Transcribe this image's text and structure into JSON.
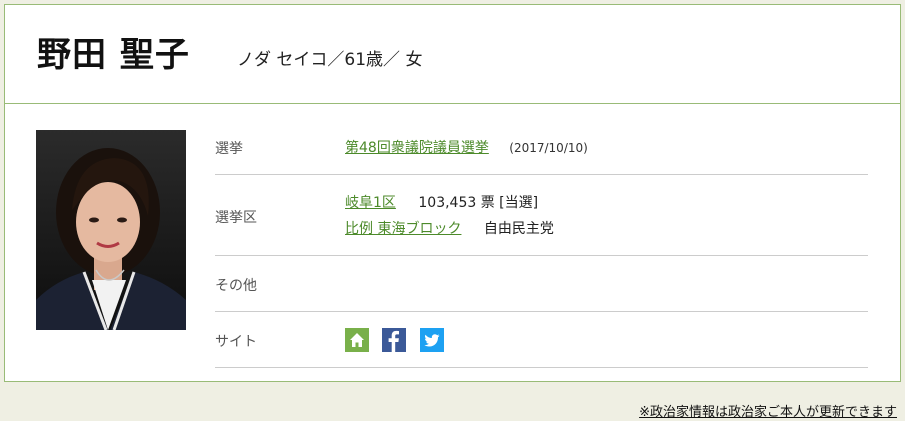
{
  "profile": {
    "name": "野田 聖子",
    "kana_age_gender": "ノダ セイコ／61歳／ 女"
  },
  "details": {
    "election": {
      "label": "選挙",
      "link_text": "第48回衆議院議員選挙",
      "date": "(2017/10/10)"
    },
    "district": {
      "label": "選挙区",
      "district_link": "岐阜1区",
      "votes": "103,453 票 [当選]",
      "pr_link": "比例 東海ブロック",
      "party": "自由民主党"
    },
    "other": {
      "label": "その他"
    },
    "site": {
      "label": "サイト",
      "icons": [
        "home-icon",
        "facebook-icon",
        "twitter-icon"
      ]
    }
  },
  "footer": {
    "note": "※政治家情報は政治家ご本人が更新できます"
  },
  "colors": {
    "border": "#99bb77",
    "link": "#4c8a2a",
    "home": "#79b04a",
    "facebook": "#3b5998",
    "twitter": "#1da1f2"
  }
}
